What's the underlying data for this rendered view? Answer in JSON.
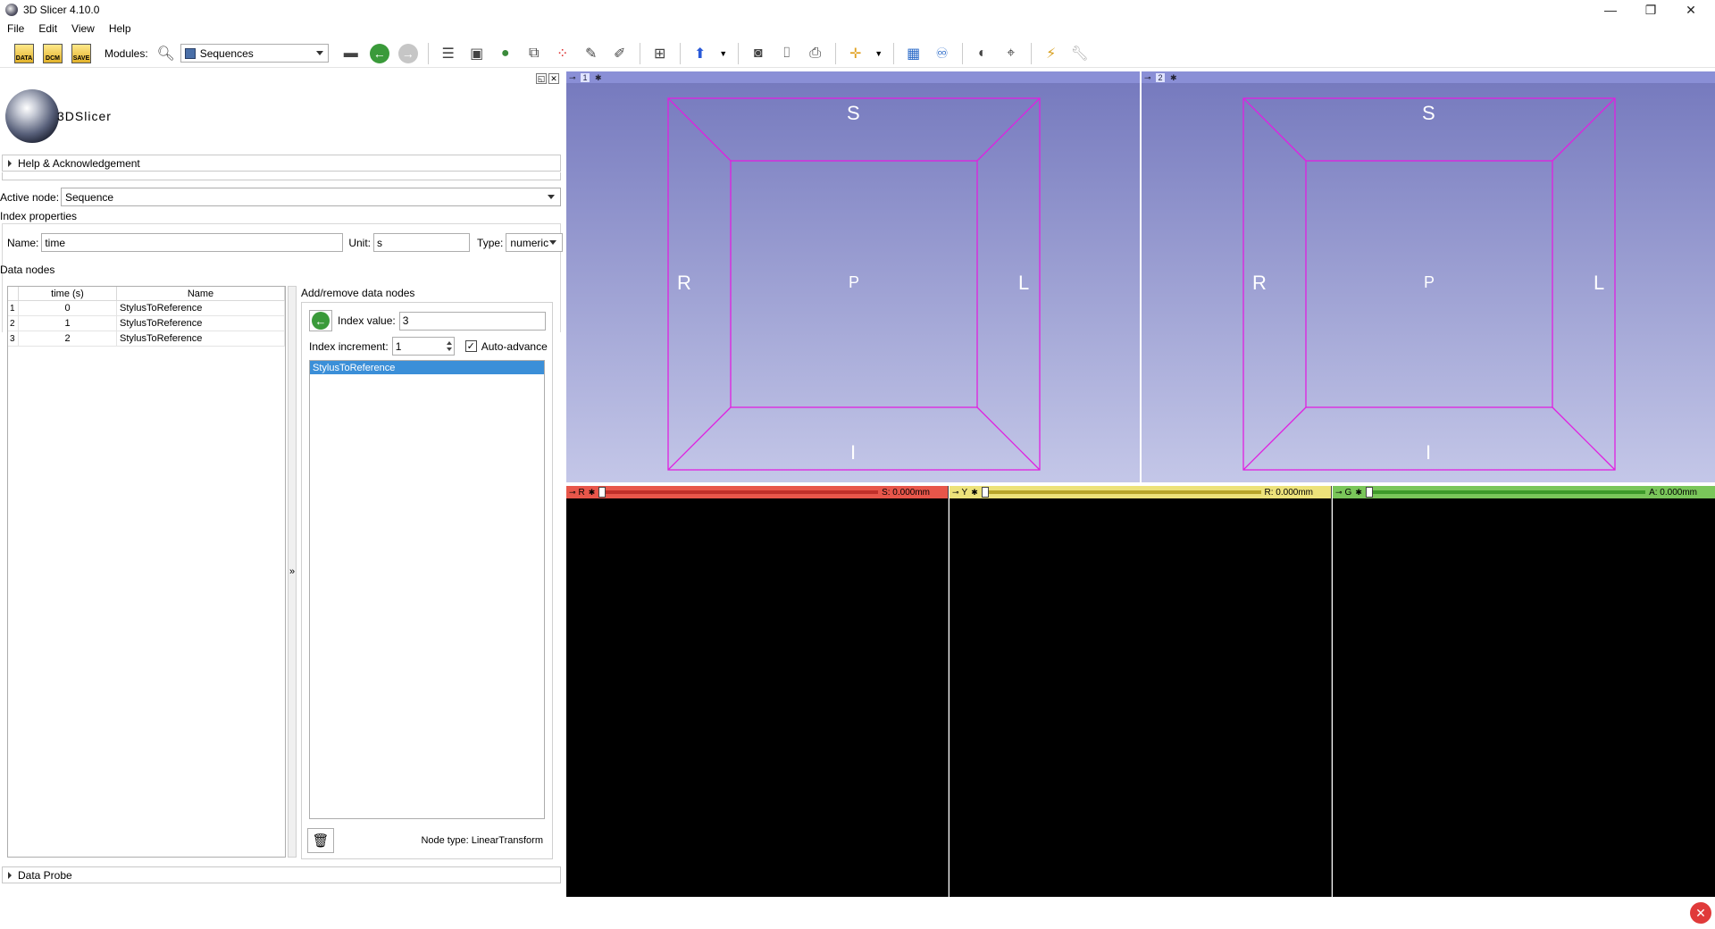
{
  "window": {
    "title": "3D Slicer 4.10.0",
    "controls": {
      "minimize": "—",
      "restore": "❐",
      "close": "✕"
    }
  },
  "menubar": [
    "File",
    "Edit",
    "View",
    "Help"
  ],
  "toolbar": {
    "data_label": "DATA",
    "dcm_label": "DCM",
    "save_label": "SAVE",
    "modules_label": "Modules:",
    "module_selected": "Sequences"
  },
  "logo_text": "3DSlicer",
  "help_section": "Help & Acknowledgement",
  "active_node": {
    "label": "Active node:",
    "value": "Sequence"
  },
  "index_properties": {
    "heading": "Index properties",
    "name_label": "Name:",
    "name_value": "time",
    "unit_label": "Unit:",
    "unit_value": "s",
    "type_label": "Type:",
    "type_value": "numeric"
  },
  "data_nodes": {
    "heading": "Data nodes",
    "columns": [
      "time (s)",
      "Name"
    ],
    "rows": [
      {
        "num": "1",
        "time": "0",
        "name": "StylusToReference"
      },
      {
        "num": "2",
        "time": "1",
        "name": "StylusToReference"
      },
      {
        "num": "3",
        "time": "2",
        "name": "StylusToReference"
      }
    ],
    "splitter_glyph": "»"
  },
  "add_remove": {
    "heading": "Add/remove data nodes",
    "index_value_label": "Index value:",
    "index_value": "3",
    "index_increment_label": "Index increment:",
    "index_increment": "1",
    "auto_advance_label": "Auto-advance",
    "auto_advance_checked": true,
    "list_items": [
      "StylusToReference"
    ],
    "node_type_text": "Node type: LinearTransform"
  },
  "data_probe": "Data Probe",
  "views3d": [
    {
      "id": "1",
      "labels": {
        "top": "S",
        "bottom": "I",
        "left": "R",
        "right": "L",
        "center": "P"
      }
    },
    {
      "id": "2",
      "labels": {
        "top": "S",
        "bottom": "I",
        "left": "R",
        "right": "L",
        "center": "P"
      }
    }
  ],
  "slices": [
    {
      "name": "R",
      "offset": "S: 0.000mm",
      "color": "#e8564a",
      "track": "#c0302a"
    },
    {
      "name": "Y",
      "offset": "R: 0.000mm",
      "color": "#ede27a",
      "track": "#b8a52a"
    },
    {
      "name": "G",
      "offset": "A: 0.000mm",
      "color": "#7ac65a",
      "track": "#3e9a2a"
    }
  ],
  "colors": {
    "view3d_top": "#7478bd",
    "view3d_bottom": "#c4c7e8",
    "box": "#e020e0",
    "selection": "#3b8fd8"
  }
}
